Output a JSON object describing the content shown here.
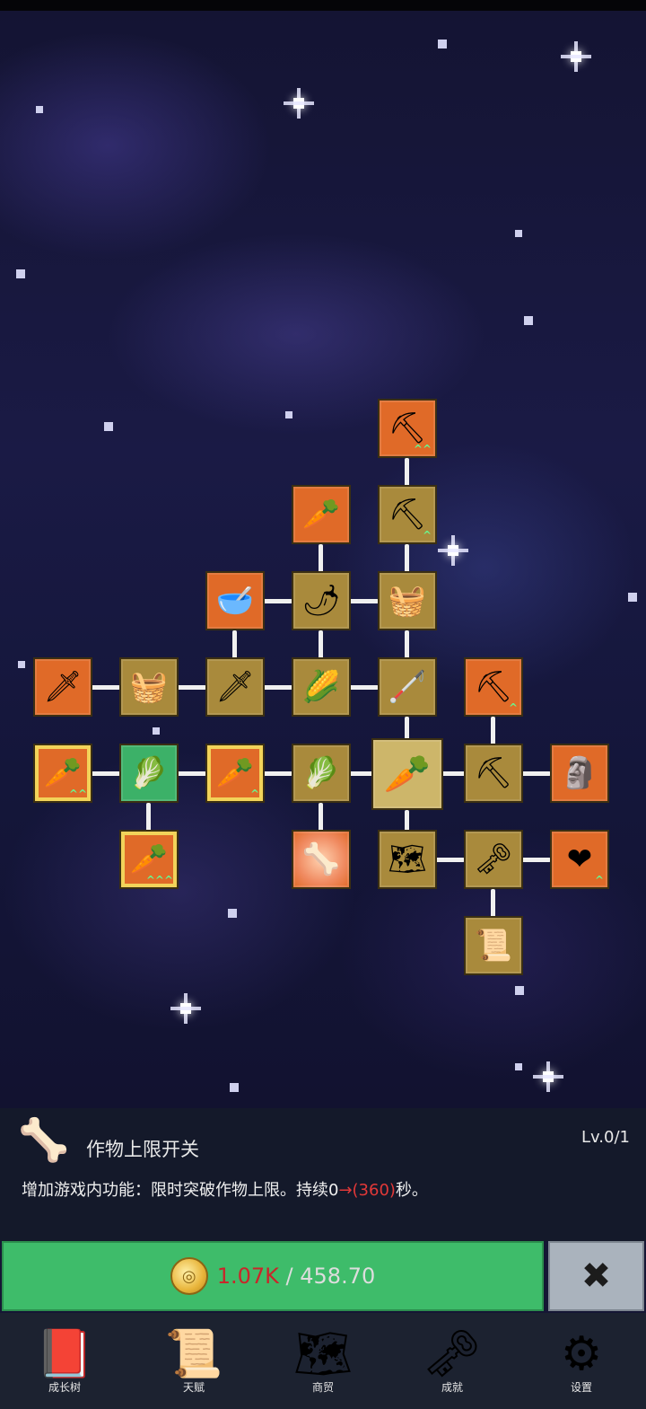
{
  "skill_tree": {
    "nodes": [
      {
        "id": "shovel-top",
        "icon": "shovel-icon",
        "glyph": "⛏",
        "style": "orange",
        "up": "^^"
      },
      {
        "id": "radish",
        "icon": "radish-icon",
        "glyph": "🥕",
        "style": "orange",
        "up": ""
      },
      {
        "id": "shovel-2",
        "icon": "shovel-icon",
        "glyph": "⛏",
        "style": "gold",
        "up": "^"
      },
      {
        "id": "bowl",
        "icon": "bowl-icon",
        "glyph": "🥣",
        "style": "orange",
        "up": ""
      },
      {
        "id": "chili",
        "icon": "chili-pepper-icon",
        "glyph": "🌶",
        "style": "gold",
        "up": ""
      },
      {
        "id": "chest-1",
        "icon": "chest-icon",
        "glyph": "🧺",
        "style": "gold",
        "up": ""
      },
      {
        "id": "sword-1",
        "icon": "sword-icon",
        "glyph": "🗡",
        "style": "orange",
        "up": ""
      },
      {
        "id": "chest-2",
        "icon": "chest-icon",
        "glyph": "🧺",
        "style": "gold",
        "up": ""
      },
      {
        "id": "sword-2",
        "icon": "sword-icon",
        "glyph": "🗡",
        "style": "gold",
        "up": ""
      },
      {
        "id": "corn",
        "icon": "corn-icon",
        "glyph": "🌽",
        "style": "gold",
        "up": ""
      },
      {
        "id": "stick",
        "icon": "stick-icon",
        "glyph": "🦯",
        "style": "gold",
        "up": ""
      },
      {
        "id": "pickaxe-1",
        "icon": "pickaxe-icon",
        "glyph": "⛏",
        "style": "orange",
        "up": "^"
      },
      {
        "id": "carrot-1",
        "icon": "carrot-icon",
        "glyph": "🥕",
        "style": "orange framed",
        "up": "^^"
      },
      {
        "id": "cabbage-1",
        "icon": "cabbage-icon",
        "glyph": "🥬",
        "style": "green",
        "up": ""
      },
      {
        "id": "carrot-2",
        "icon": "carrot-icon",
        "glyph": "🥕",
        "style": "orange framed",
        "up": "^"
      },
      {
        "id": "cabbage-2",
        "icon": "cabbage-icon",
        "glyph": "🥬",
        "style": "gold",
        "up": ""
      },
      {
        "id": "carrot-selected",
        "icon": "carrot-icon",
        "glyph": "🥕",
        "style": "selected",
        "up": ""
      },
      {
        "id": "pickaxe-2",
        "icon": "pickaxe-icon",
        "glyph": "⛏",
        "style": "gold",
        "up": ""
      },
      {
        "id": "statue",
        "icon": "statue-icon",
        "glyph": "🗿",
        "style": "orange",
        "up": ""
      },
      {
        "id": "carrot-3",
        "icon": "carrot-icon",
        "glyph": "🥕",
        "style": "orange framed",
        "up": "^^^"
      },
      {
        "id": "bone-stick",
        "icon": "bone-stick-icon",
        "glyph": "🦴",
        "style": "radiant",
        "up": ""
      },
      {
        "id": "map",
        "icon": "map-icon",
        "glyph": "🗺",
        "style": "gold",
        "up": ""
      },
      {
        "id": "key",
        "icon": "key-icon",
        "glyph": "🗝",
        "style": "gold",
        "up": ""
      },
      {
        "id": "heart",
        "icon": "heart-icon",
        "glyph": "❤",
        "style": "orange",
        "up": "^"
      },
      {
        "id": "scroll",
        "icon": "scroll-icon",
        "glyph": "📜",
        "style": "gold",
        "up": ""
      }
    ]
  },
  "panel": {
    "icon": "bone-stick-icon",
    "icon_glyph": "🦴",
    "title": "作物上限开关",
    "level": "Lv.0/1",
    "desc_prefix": "增加游戏内功能：限时突破作物上限。持续0",
    "desc_highlight": "→(360)",
    "desc_suffix": "秒。"
  },
  "action": {
    "coin_glyph": "◎",
    "cost": "1.07K",
    "separator": " / ",
    "balance": "458.70",
    "close_glyph": "✖"
  },
  "nav": {
    "items": [
      {
        "label": "成长树",
        "icon": "book-icon",
        "glyph": "📕"
      },
      {
        "label": "天赋",
        "icon": "scroll-icon",
        "glyph": "📜"
      },
      {
        "label": "商贸",
        "icon": "map-icon",
        "glyph": "🗺"
      },
      {
        "label": "成就",
        "icon": "key-icon",
        "glyph": "🗝"
      },
      {
        "label": "设置",
        "icon": "gear-icon",
        "glyph": "⚙"
      }
    ]
  },
  "colors": {
    "node_gold": "#a98a3c",
    "node_orange": "#e06a28",
    "node_green": "#3cb168",
    "buy_green": "#3ebc6a",
    "cost_red": "#c9262a"
  }
}
